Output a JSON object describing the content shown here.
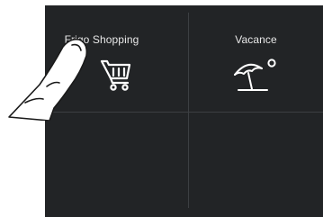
{
  "tiles": [
    {
      "label": "Frigo Shopping",
      "icon": "shopping-cart-icon"
    },
    {
      "label": "Vacance",
      "icon": "beach-umbrella-sun-icon"
    },
    {
      "label": "",
      "icon": ""
    },
    {
      "label": "",
      "icon": ""
    }
  ],
  "colors": {
    "panel": "#222426",
    "divider": "#3c3f42",
    "text": "#e8e8e8",
    "icon_stroke": "#ffffff"
  }
}
